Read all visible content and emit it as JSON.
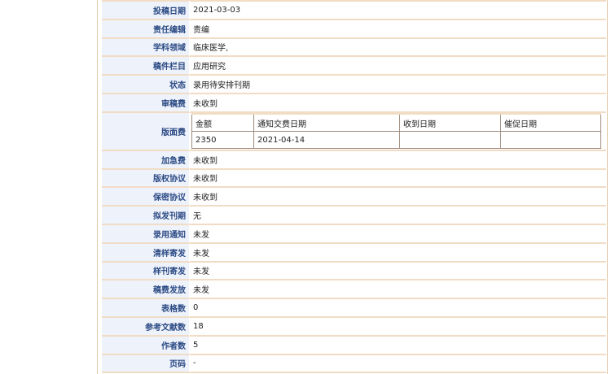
{
  "rows": [
    {
      "label": "投稿日期",
      "value": "2021-03-03"
    },
    {
      "label": "责任编辑",
      "value": "责编"
    },
    {
      "label": "学科领域",
      "value": "临床医学,"
    },
    {
      "label": "稿件栏目",
      "value": "应用研究"
    },
    {
      "label": "状态",
      "value": "录用待安排刊期"
    },
    {
      "label": "审稿费",
      "value": "未收到"
    }
  ],
  "fee": {
    "label": "版面费",
    "headers": [
      "金额",
      "通知交费日期",
      "收到日期",
      "催促日期"
    ],
    "values": [
      "2350",
      "2021-04-14",
      "",
      ""
    ]
  },
  "rows2": [
    {
      "label": "加急费",
      "value": "未收到"
    },
    {
      "label": "版权协议",
      "value": "未收到"
    },
    {
      "label": "保密协议",
      "value": "未收到"
    },
    {
      "label": "拟发刊期",
      "value": "无"
    },
    {
      "label": "录用通知",
      "value": "未发"
    },
    {
      "label": "清样寄发",
      "value": "未发"
    },
    {
      "label": "样刊寄发",
      "value": "未发"
    },
    {
      "label": "稿费发放",
      "value": "未发"
    },
    {
      "label": "表格数",
      "value": "0"
    },
    {
      "label": "参考文献数",
      "value": "18"
    },
    {
      "label": "作者数",
      "value": "5"
    },
    {
      "label": "页码",
      "value": "-"
    }
  ]
}
